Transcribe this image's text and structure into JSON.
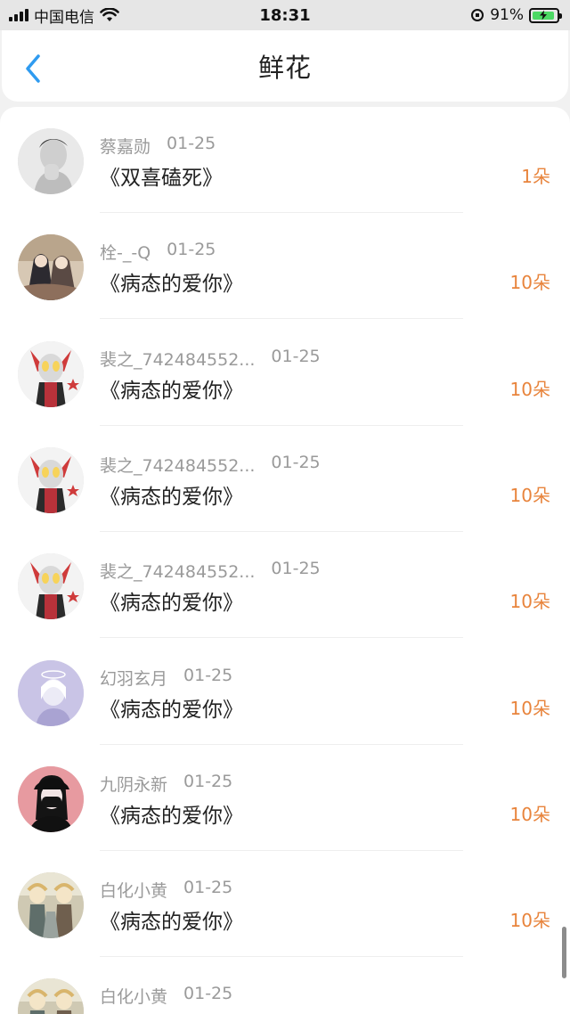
{
  "status_bar": {
    "carrier": "中国电信",
    "time": "18:31",
    "battery_percent": "91%",
    "battery_level": 0.91
  },
  "header": {
    "back_icon": "chevron-left-icon",
    "title": "鲜花"
  },
  "items": [
    {
      "user": "蔡嘉勋",
      "date": "01-25",
      "book": "《双喜磕死》",
      "count": "1朵",
      "avatar_kind": "portrait-bw"
    },
    {
      "user": "栓-_-Q",
      "date": "01-25",
      "book": "《病态的爱你》",
      "count": "10朵",
      "avatar_kind": "anime-pair"
    },
    {
      "user": "裴之_742484552...",
      "date": "01-25",
      "book": "《病态的爱你》",
      "count": "10朵",
      "avatar_kind": "anime-hero"
    },
    {
      "user": "裴之_742484552...",
      "date": "01-25",
      "book": "《病态的爱你》",
      "count": "10朵",
      "avatar_kind": "anime-hero"
    },
    {
      "user": "裴之_742484552...",
      "date": "01-25",
      "book": "《病态的爱你》",
      "count": "10朵",
      "avatar_kind": "anime-hero"
    },
    {
      "user": "幻羽玄月",
      "date": "01-25",
      "book": "《病态的爱你》",
      "count": "10朵",
      "avatar_kind": "lavender-angel"
    },
    {
      "user": "九阴永新",
      "date": "01-25",
      "book": "《病态的爱你》",
      "count": "10朵",
      "avatar_kind": "pink-masked"
    },
    {
      "user": "白化小黄",
      "date": "01-25",
      "book": "《病态的爱你》",
      "count": "10朵",
      "avatar_kind": "anime-group"
    },
    {
      "user": "白化小黄",
      "date": "01-25",
      "book": "",
      "count": "",
      "avatar_kind": "anime-group"
    }
  ],
  "colors": {
    "accent_blue": "#2f9bf0",
    "count_orange": "#e8843c",
    "meta_gray": "#9a9a9a"
  }
}
